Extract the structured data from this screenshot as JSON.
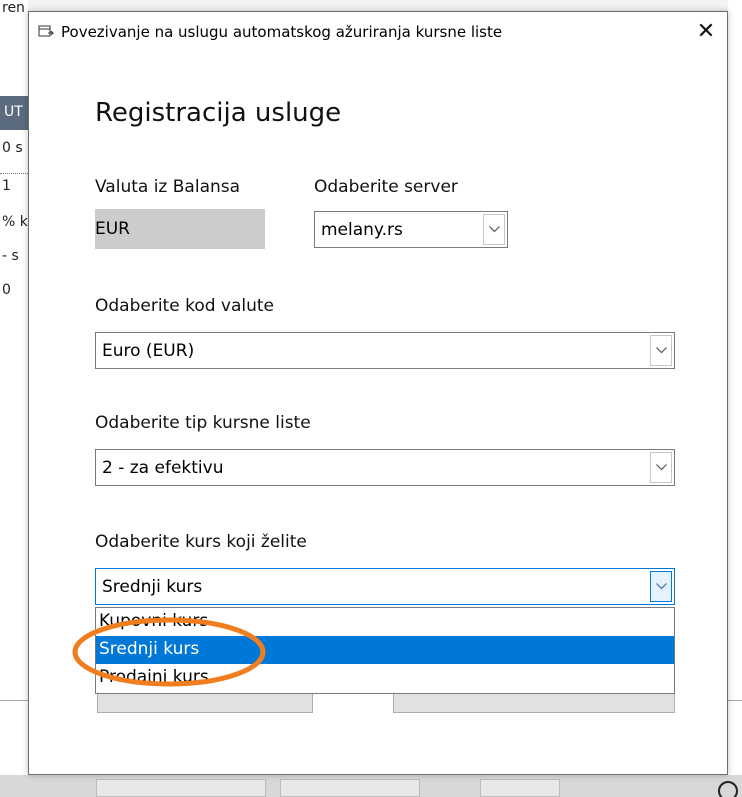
{
  "background": {
    "left_fragments": [
      "ren",
      "UT",
      "0 s",
      "1",
      "% k",
      "- s",
      "0"
    ]
  },
  "dialog": {
    "title": "Povezivanje na uslugu automatskog ažuriranja kursne liste",
    "close_symbol": "✕",
    "heading": "Registracija usluge",
    "currency_label": "Valuta iz Balansa",
    "currency_value": "EUR",
    "server_label": "Odaberite server",
    "server_value": "melany.rs",
    "currency_code_label": "Odaberite kod valute",
    "currency_code_value": "Euro (EUR)",
    "rate_list_type_label": "Odaberite tip kursne liste",
    "rate_list_type_value": "2 - za efektivu",
    "rate_label": "Odaberite kurs koji želite",
    "rate_value": "Srednji kurs",
    "rate_options": [
      "Kupovni kurs",
      "Srednji kurs",
      "Prodajni kurs"
    ],
    "rate_selected_index": 1
  },
  "colors": {
    "selection": "#0078d7",
    "annotation": "#f07d1e",
    "readonly_bg": "#cccccc"
  }
}
